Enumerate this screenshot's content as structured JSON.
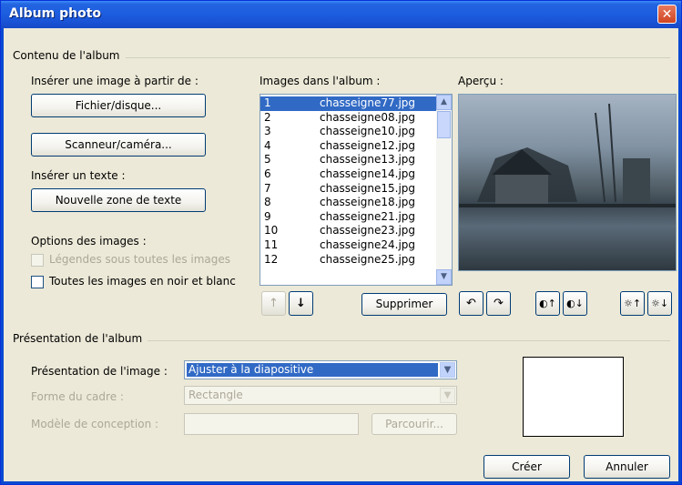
{
  "window": {
    "title": "Album photo"
  },
  "content_group": {
    "label": "Contenu de l'album"
  },
  "insert_image": {
    "label": "Insérer une image à partir de :",
    "file_button": "Fichier/disque...",
    "scanner_button": "Scanneur/caméra..."
  },
  "insert_text": {
    "label": "Insérer un texte :",
    "textbox_button": "Nouvelle zone de texte"
  },
  "image_options": {
    "label": "Options des images :",
    "captions": {
      "label": "Légendes sous toutes les images",
      "checked": false,
      "enabled": false
    },
    "black_white": {
      "label": "Toutes les images en noir et blanc",
      "checked": false,
      "enabled": true
    }
  },
  "album_list": {
    "label": "Images dans l'album :",
    "items": [
      {
        "num": "1",
        "name": "chasseigne77.jpg",
        "selected": true
      },
      {
        "num": "2",
        "name": "chasseigne08.jpg"
      },
      {
        "num": "3",
        "name": "chasseigne10.jpg"
      },
      {
        "num": "4",
        "name": "chasseigne12.jpg"
      },
      {
        "num": "5",
        "name": "chasseigne13.jpg"
      },
      {
        "num": "6",
        "name": "chasseigne14.jpg"
      },
      {
        "num": "7",
        "name": "chasseigne15.jpg"
      },
      {
        "num": "8",
        "name": "chasseigne18.jpg"
      },
      {
        "num": "9",
        "name": "chasseigne21.jpg"
      },
      {
        "num": "10",
        "name": "chasseigne23.jpg"
      },
      {
        "num": "11",
        "name": "chasseigne24.jpg"
      },
      {
        "num": "12",
        "name": "chasseigne25.jpg"
      }
    ],
    "move_up": "↑",
    "move_down": "↓",
    "delete_button": "Supprimer"
  },
  "preview": {
    "label": "Aperçu :"
  },
  "image_tools": {
    "rotate_left": "↶",
    "rotate_right": "↷",
    "contrast_up": "◐↑",
    "contrast_down": "◐↓",
    "brightness_up": "☼↑",
    "brightness_down": "☼↓"
  },
  "layout_group": {
    "label": "Présentation de l'album",
    "picture_layout": {
      "label": "Présentation de l'image :",
      "value": "Ajuster à la diapositive"
    },
    "frame_shape": {
      "label": "Forme du cadre :",
      "value": "Rectangle"
    },
    "design_template": {
      "label": "Modèle de conception :",
      "value": "",
      "browse_button": "Parcourir..."
    }
  },
  "footer": {
    "create_button": "Créer",
    "cancel_button": "Annuler"
  },
  "colors": {
    "title_bar": "#1d5ee0",
    "selection": "#316ac5",
    "dialog_bg": "#ece9d8",
    "close": "#cf4522"
  }
}
